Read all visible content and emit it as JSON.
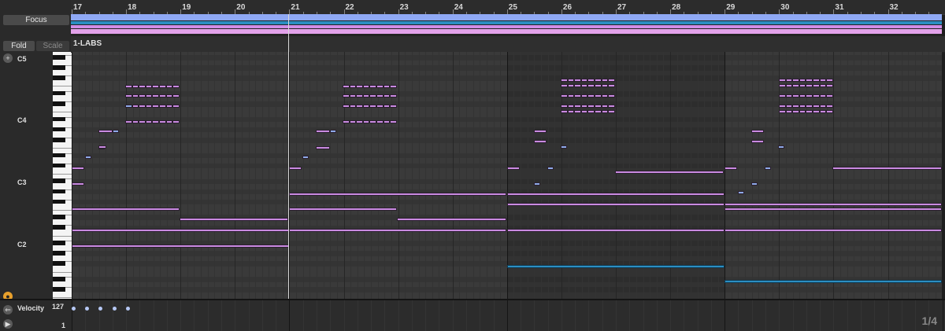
{
  "left_panel": {
    "focus_label": "Focus",
    "fold_label": "Fold",
    "scale_label": "Scale",
    "pitch_labels": [
      "C5",
      "C4",
      "C3",
      "C2"
    ],
    "velocity_label": "Velocity",
    "velocity_max": "127",
    "velocity_min": "1"
  },
  "ruler": {
    "bars": [
      "17",
      "18",
      "19",
      "20",
      "21",
      "22",
      "23",
      "24",
      "25",
      "26",
      "27",
      "28",
      "29",
      "30",
      "31",
      "32"
    ]
  },
  "clip": {
    "name": "1-LABS"
  },
  "page_indicator": "1/4",
  "colors": {
    "note_pink": "#c98ae0",
    "note_blue": "#8eaae8",
    "note_cyan": "#2b8ec2",
    "loop_bar": "#8fa9f5"
  },
  "icons": [
    "plus-icon",
    "record-icon",
    "velocity-toggle-icon",
    "play-icon"
  ]
}
